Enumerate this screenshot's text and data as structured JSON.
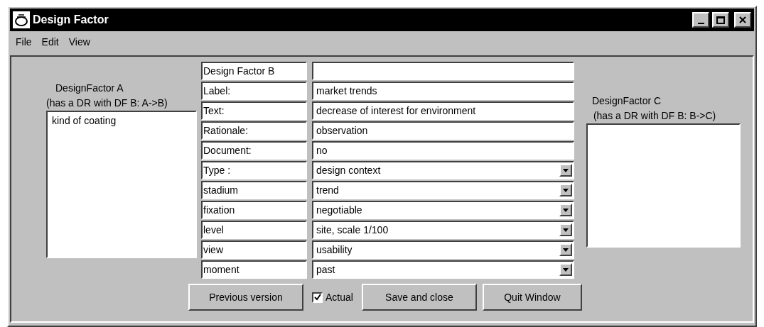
{
  "window": {
    "title": "Design Factor"
  },
  "menu": [
    "File",
    "Edit",
    "View"
  ],
  "left_panel": {
    "title": "DesignFactor A",
    "subtitle": "(has a DR with DF B: A->B)",
    "items": [
      "kind of coating"
    ]
  },
  "fields": [
    {
      "label": "Design Factor B",
      "kind": "text"
    },
    {
      "label": "Label:",
      "value": "market trends",
      "kind": "text"
    },
    {
      "label": "Text:",
      "value": "decrease of interest for environment",
      "kind": "text"
    },
    {
      "label": "Rationale:",
      "value": "observation",
      "kind": "text"
    },
    {
      "label": "Document:",
      "value": "no",
      "kind": "text"
    },
    {
      "label": "Type :",
      "value": "design context",
      "kind": "dropdown"
    },
    {
      "label": "stadium",
      "value": "trend",
      "kind": "dropdown"
    },
    {
      "label": "fixation",
      "value": "negotiable",
      "kind": "dropdown"
    },
    {
      "label": "level",
      "value": "site, scale 1/100",
      "kind": "dropdown"
    },
    {
      "label": "view",
      "value": "usability",
      "kind": "dropdown"
    },
    {
      "label": "moment",
      "value": "past",
      "kind": "dropdown"
    }
  ],
  "right_panel": {
    "title": "DesignFactor C",
    "subtitle": "(has a DR with DF B: B->C)"
  },
  "buttons": {
    "previous": "Previous version",
    "actual": {
      "label": "Actual",
      "checked": true
    },
    "save": "Save and close",
    "quit": "Quit Window"
  }
}
